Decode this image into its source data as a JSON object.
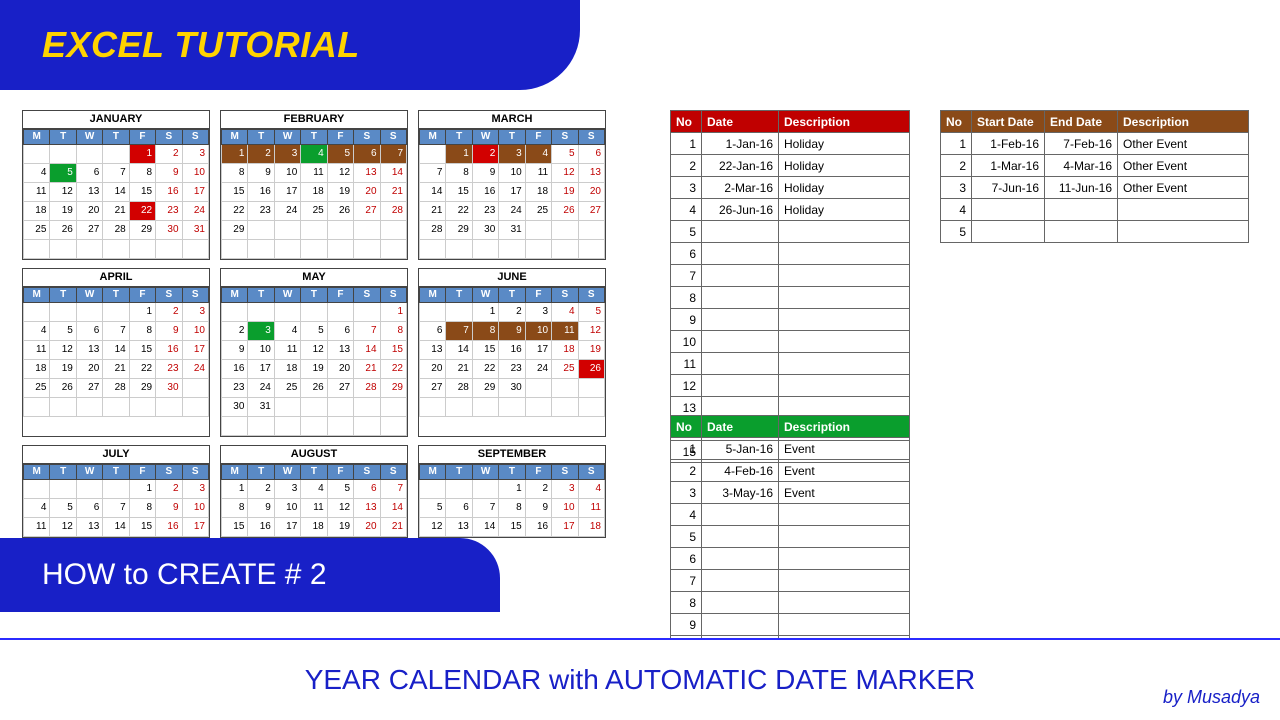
{
  "header": {
    "title": "EXCEL TUTORIAL"
  },
  "mid": {
    "title": "HOW to CREATE # 2"
  },
  "footer": {
    "caption": "YEAR CALENDAR with AUTOMATIC DATE MARKER",
    "byline": "by Musadya"
  },
  "weekday_labels": [
    "M",
    "T",
    "W",
    "T",
    "F",
    "S",
    "S"
  ],
  "months": [
    {
      "name": "JANUARY",
      "start": 4,
      "days": 31,
      "marks": {
        "1": "red",
        "5": "green",
        "22": "red"
      }
    },
    {
      "name": "FEBRUARY",
      "start": 0,
      "days": 29,
      "marks": {
        "1": "brown",
        "2": "brown",
        "3": "brown",
        "4": "green",
        "5": "brown",
        "6": "brown",
        "7": "brown"
      }
    },
    {
      "name": "MARCH",
      "start": 1,
      "days": 31,
      "marks": {
        "1": "brown",
        "2": "red",
        "3": "brown",
        "4": "brown"
      }
    },
    {
      "name": "APRIL",
      "start": 4,
      "days": 30,
      "marks": {}
    },
    {
      "name": "MAY",
      "start": 6,
      "days": 31,
      "marks": {
        "3": "green"
      }
    },
    {
      "name": "JUNE",
      "start": 2,
      "days": 30,
      "marks": {
        "7": "brown",
        "8": "brown",
        "9": "brown",
        "10": "brown",
        "11": "brown",
        "26": "red"
      }
    },
    {
      "name": "JULY",
      "start": 4,
      "days": 31,
      "marks": {}
    },
    {
      "name": "AUGUST",
      "start": 0,
      "days": 31,
      "marks": {}
    },
    {
      "name": "SEPTEMBER",
      "start": 3,
      "days": 30,
      "marks": {}
    }
  ],
  "visible_weeks": [
    6,
    6,
    6,
    6,
    7,
    6,
    3,
    3,
    3
  ],
  "tables": {
    "holidays": {
      "headers": [
        "No",
        "Date",
        "Description"
      ],
      "rows": [
        {
          "no": 1,
          "date": "1-Jan-16",
          "desc": "Holiday"
        },
        {
          "no": 2,
          "date": "22-Jan-16",
          "desc": "Holiday"
        },
        {
          "no": 3,
          "date": "2-Mar-16",
          "desc": "Holiday"
        },
        {
          "no": 4,
          "date": "26-Jun-16",
          "desc": "Holiday"
        }
      ],
      "blank_rows": 11
    },
    "events": {
      "headers": [
        "No",
        "Date",
        "Description"
      ],
      "rows": [
        {
          "no": 1,
          "date": "5-Jan-16",
          "desc": "Event"
        },
        {
          "no": 2,
          "date": "4-Feb-16",
          "desc": "Event"
        },
        {
          "no": 3,
          "date": "3-May-16",
          "desc": "Event"
        }
      ],
      "blank_rows": 7
    },
    "other": {
      "headers": [
        "No",
        "Start Date",
        "End Date",
        "Description"
      ],
      "rows": [
        {
          "no": 1,
          "start": "1-Feb-16",
          "end": "7-Feb-16",
          "desc": "Other Event"
        },
        {
          "no": 2,
          "start": "1-Mar-16",
          "end": "4-Mar-16",
          "desc": "Other Event"
        },
        {
          "no": 3,
          "start": "7-Jun-16",
          "end": "11-Jun-16",
          "desc": "Other Event"
        }
      ],
      "blank_rows": 2
    }
  }
}
